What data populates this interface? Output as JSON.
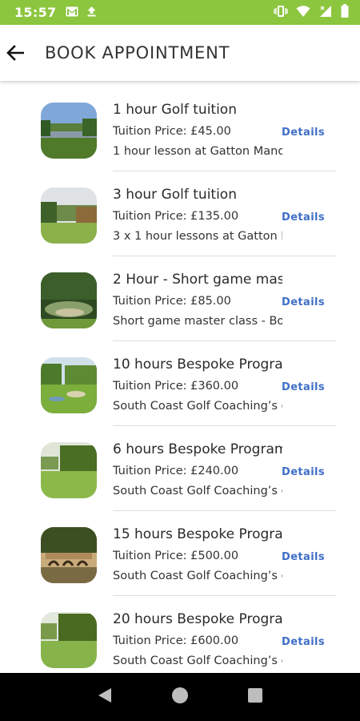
{
  "status_bar": {
    "time": "15:57",
    "icons": [
      "gmail-icon",
      "upload-icon",
      "vibrate-icon",
      "wifi-icon",
      "signal-icon",
      "battery-icon"
    ]
  },
  "app_bar": {
    "back_icon": "back-arrow-icon",
    "title": "BOOK APPOINTMENT"
  },
  "appointments": [
    {
      "name": "1 hour Golf tuition",
      "price": "Tuition Price: £45.00",
      "details": "Details",
      "description": "1 hour lesson at Gatton Mano"
    },
    {
      "name": "3 hour Golf tuition",
      "price": "Tuition Price: £135.00",
      "details": "Details",
      "description": "3 x 1 hour lessons at Gatton M"
    },
    {
      "name": "2 Hour - Short game mast",
      "price": "Tuition Price: £85.00",
      "details": "Details",
      "description": "Short game master class - Bo"
    },
    {
      "name": "10 hours Bespoke Prograr",
      "price": "Tuition Price: £360.00",
      "details": "Details",
      "description": "South Coast Golf Coaching’s c"
    },
    {
      "name": "6 hours Bespoke Program",
      "price": "Tuition Price: £240.00",
      "details": "Details",
      "description": "South Coast Golf Coaching’s c"
    },
    {
      "name": "15 hours Bespoke Prograr",
      "price": "Tuition Price: £500.00",
      "details": "Details",
      "description": "South Coast Golf Coaching’s c"
    },
    {
      "name": "20 hours Bespoke Prograr",
      "price": "Tuition Price: £600.00",
      "details": "Details",
      "description": "South Coast Golf Coaching’s c"
    }
  ],
  "nav_bar": {
    "icons": [
      "nav-back-icon",
      "nav-home-icon",
      "nav-recents-icon"
    ]
  },
  "colors": {
    "status_bar": "#8cc63f",
    "details_link": "#3f6fc6",
    "nav_bar": "#000000"
  }
}
